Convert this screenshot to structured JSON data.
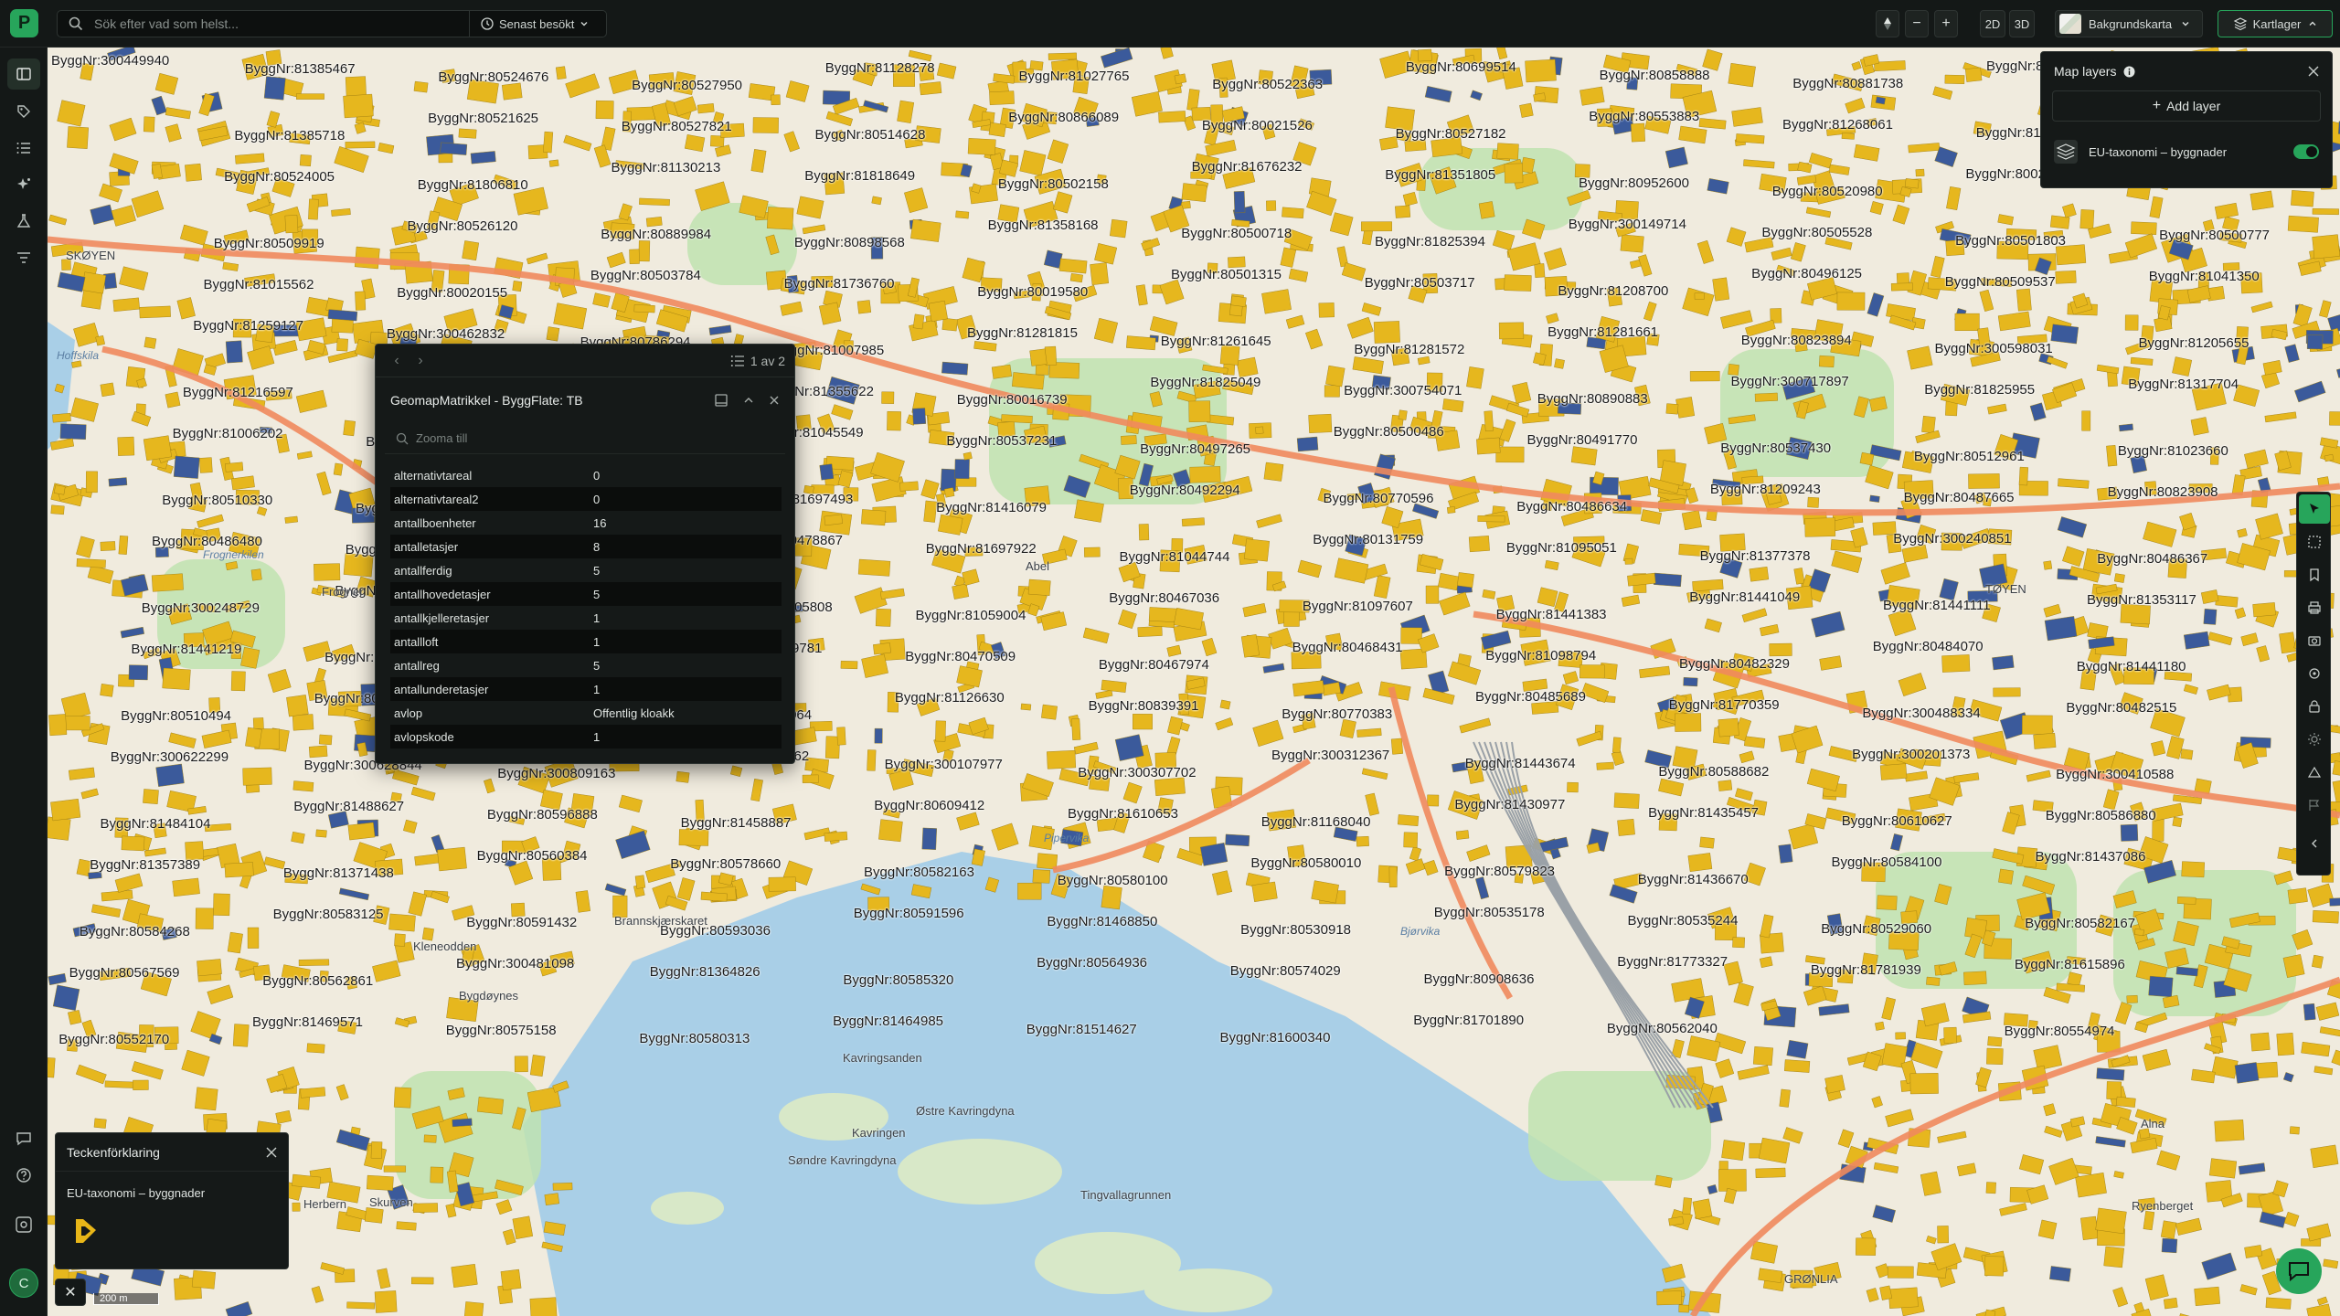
{
  "topbar": {
    "logo": "P",
    "search_placeholder": "Sök efter vad som helst...",
    "recent_label": "Senast besökt",
    "zoom_out": "−",
    "zoom_in": "+",
    "mode_2d": "2D",
    "mode_3d": "3D",
    "basemap_label": "Bakgrundskarta",
    "maptypes_label": "Kartlager"
  },
  "sidebar": {
    "icons": [
      "map-icon",
      "tag-icon",
      "list-icon",
      "sparkle-icon",
      "flask-icon",
      "filter-icon"
    ],
    "bottom_icons": [
      "chat-bubble-icon",
      "help-icon",
      "settings-icon"
    ],
    "avatar": "C"
  },
  "map": {
    "building_labels": [
      {
        "t": "ByggNr:300449940"
      },
      {
        "t": "ByggNr:81385467"
      },
      {
        "t": "ByggNr:80524676"
      },
      {
        "t": "ByggNr:80527950"
      },
      {
        "t": "ByggNr:81128278"
      },
      {
        "t": "ByggNr:81027765"
      },
      {
        "t": "ByggNr:80522363"
      },
      {
        "t": "ByggNr:80699514"
      },
      {
        "t": "ByggNr:80858888"
      },
      {
        "t": "ByggNr:80881738"
      },
      {
        "t": "ByggNr:80523637"
      },
      {
        "t": "ByggNr:80515464"
      },
      {
        "t": "ByggNr:81385718"
      },
      {
        "t": "ByggNr:80521625"
      },
      {
        "t": "ByggNr:80527821"
      },
      {
        "t": "ByggNr:80514628"
      },
      {
        "t": "ByggNr:80866089"
      },
      {
        "t": "ByggNr:80021526"
      },
      {
        "t": "ByggNr:80527182"
      },
      {
        "t": "ByggNr:80553883"
      },
      {
        "t": "ByggNr:81268061"
      },
      {
        "t": "ByggNr:81268347"
      },
      {
        "t": "ByggNr:81351570"
      },
      {
        "t": "ByggNr:80524005"
      },
      {
        "t": "ByggNr:81806810"
      },
      {
        "t": "ByggNr:81130213"
      },
      {
        "t": "ByggNr:81818649"
      },
      {
        "t": "ByggNr:80502158"
      },
      {
        "t": "ByggNr:81676232"
      },
      {
        "t": "ByggNr:81351805"
      },
      {
        "t": "ByggNr:80952600"
      },
      {
        "t": "ByggNr:80520980"
      },
      {
        "t": "ByggNr:80020120"
      },
      {
        "t": "ByggNr:80500777"
      },
      {
        "t": "ByggNr:80509919"
      },
      {
        "t": "ByggNr:80526120"
      },
      {
        "t": "ByggNr:80889984"
      },
      {
        "t": "ByggNr:80898568"
      },
      {
        "t": "ByggNr:81358168"
      },
      {
        "t": "ByggNr:80500718"
      },
      {
        "t": "ByggNr:81825394"
      },
      {
        "t": "ByggNr:300149714"
      },
      {
        "t": "ByggNr:80505528"
      },
      {
        "t": "ByggNr:80501803"
      },
      {
        "t": "ByggNr:81041350"
      },
      {
        "t": "ByggNr:81015562"
      },
      {
        "t": "ByggNr:80020155"
      },
      {
        "t": "ByggNr:80503784"
      },
      {
        "t": "ByggNr:81736760"
      },
      {
        "t": "ByggNr:80019580"
      },
      {
        "t": "ByggNr:80501315"
      },
      {
        "t": "ByggNr:80503717"
      },
      {
        "t": "ByggNr:81208700"
      },
      {
        "t": "ByggNr:80496125"
      },
      {
        "t": "ByggNr:80509537"
      },
      {
        "t": "ByggNr:81205655"
      },
      {
        "t": "ByggNr:81259127"
      },
      {
        "t": "ByggNr:300462832"
      },
      {
        "t": "ByggNr:80786294"
      },
      {
        "t": "ByggNr:81007985"
      },
      {
        "t": "ByggNr:81281815"
      },
      {
        "t": "ByggNr:81261645"
      },
      {
        "t": "ByggNr:81281572"
      },
      {
        "t": "ByggNr:81281661"
      },
      {
        "t": "ByggNr:80823894"
      },
      {
        "t": "ByggNr:300598031"
      },
      {
        "t": "ByggNr:81317704"
      },
      {
        "t": "ByggNr:81216597"
      },
      {
        "t": "ByggNr:80878265"
      },
      {
        "t": "ByggNr:81317459"
      },
      {
        "t": "ByggNr:81355622"
      },
      {
        "t": "ByggNr:80016739"
      },
      {
        "t": "ByggNr:81825049"
      },
      {
        "t": "ByggNr:300754071"
      },
      {
        "t": "ByggNr:80890883"
      },
      {
        "t": "ByggNr:300717897"
      },
      {
        "t": "ByggNr:81825955"
      },
      {
        "t": "ByggNr:81023660"
      },
      {
        "t": "ByggNr:81006202"
      },
      {
        "t": "ByggNr:81180059"
      },
      {
        "t": "ByggNr:80014574"
      },
      {
        "t": "ByggNr:81045549"
      },
      {
        "t": "ByggNr:80537231"
      },
      {
        "t": "ByggNr:80497265"
      },
      {
        "t": "ByggNr:80500486"
      },
      {
        "t": "ByggNr:80491770"
      },
      {
        "t": "ByggNr:80537430"
      },
      {
        "t": "ByggNr:80512961"
      },
      {
        "t": "ByggNr:80823908"
      },
      {
        "t": "ByggNr:80510330"
      },
      {
        "t": "ByggNr:81415945"
      },
      {
        "t": "ByggNr:80509204"
      },
      {
        "t": "ByggNr:81697493"
      },
      {
        "t": "ByggNr:81416079"
      },
      {
        "t": "ByggNr:80492294"
      },
      {
        "t": "ByggNr:80770596"
      },
      {
        "t": "ByggNr:80486634"
      },
      {
        "t": "ByggNr:81209243"
      },
      {
        "t": "ByggNr:80487665"
      },
      {
        "t": "ByggNr:80486367"
      },
      {
        "t": "ByggNr:80486480"
      },
      {
        "t": "ByggNr:80489064"
      },
      {
        "t": "ByggNr:81204766"
      },
      {
        "t": "ByggNr:80478867"
      },
      {
        "t": "ByggNr:81697922"
      },
      {
        "t": "ByggNr:81044744"
      },
      {
        "t": "ByggNr:80131759"
      },
      {
        "t": "ByggNr:81095051"
      },
      {
        "t": "ByggNr:81377378"
      },
      {
        "t": "ByggNr:300240851"
      },
      {
        "t": "ByggNr:81353117"
      },
      {
        "t": "ByggNr:300248729"
      },
      {
        "t": "ByggNr:81215146"
      },
      {
        "t": "ByggNr:81166242"
      },
      {
        "t": "ByggNr:81405808"
      },
      {
        "t": "ByggNr:81059004"
      },
      {
        "t": "ByggNr:80467036"
      },
      {
        "t": "ByggNr:81097607"
      },
      {
        "t": "ByggNr:81441383"
      },
      {
        "t": "ByggNr:81441049"
      },
      {
        "t": "ByggNr:81441111"
      },
      {
        "t": "ByggNr:81441180"
      },
      {
        "t": "ByggNr:81441219"
      },
      {
        "t": "ByggNr:81455793"
      },
      {
        "t": "ByggNr:81485690"
      },
      {
        "t": "ByggNr:81849781"
      },
      {
        "t": "ByggNr:80470509"
      },
      {
        "t": "ByggNr:80467974"
      },
      {
        "t": "ByggNr:80468431"
      },
      {
        "t": "ByggNr:81098794"
      },
      {
        "t": "ByggNr:80482329"
      },
      {
        "t": "ByggNr:80484070"
      },
      {
        "t": "ByggNr:80482515"
      },
      {
        "t": "ByggNr:80510494"
      },
      {
        "t": "ByggNr:80478097"
      },
      {
        "t": "ByggNr:80480288"
      },
      {
        "t": "ByggNr:81079064"
      },
      {
        "t": "ByggNr:81126630"
      },
      {
        "t": "ByggNr:80839391"
      },
      {
        "t": "ByggNr:80770383"
      },
      {
        "t": "ByggNr:80485689"
      },
      {
        "t": "ByggNr:81770359"
      },
      {
        "t": "ByggNr:300488334"
      },
      {
        "t": "ByggNr:300410588"
      },
      {
        "t": "ByggNr:300622299"
      },
      {
        "t": "ByggNr:300628844"
      },
      {
        "t": "ByggNr:300809163"
      },
      {
        "t": "ByggNr:300368362"
      },
      {
        "t": "ByggNr:300107977"
      },
      {
        "t": "ByggNr:300307702"
      },
      {
        "t": "ByggNr:300312367"
      },
      {
        "t": "ByggNr:81443674"
      },
      {
        "t": "ByggNr:80588682"
      },
      {
        "t": "ByggNr:300201373"
      },
      {
        "t": "ByggNr:80586880"
      },
      {
        "t": "ByggNr:81484104"
      },
      {
        "t": "ByggNr:81488627"
      },
      {
        "t": "ByggNr:80596888"
      },
      {
        "t": "ByggNr:81458887"
      },
      {
        "t": "ByggNr:80609412"
      },
      {
        "t": "ByggNr:81610653"
      },
      {
        "t": "ByggNr:81168040"
      },
      {
        "t": "ByggNr:81430977"
      },
      {
        "t": "ByggNr:81435457"
      },
      {
        "t": "ByggNr:80610627"
      },
      {
        "t": "ByggNr:81437086"
      },
      {
        "t": "ByggNr:81357389"
      },
      {
        "t": "ByggNr:81371438"
      },
      {
        "t": "ByggNr:80560384"
      },
      {
        "t": "ByggNr:80578660"
      },
      {
        "t": "ByggNr:80582163"
      },
      {
        "t": "ByggNr:80580100"
      },
      {
        "t": "ByggNr:80580010"
      },
      {
        "t": "ByggNr:80579823"
      },
      {
        "t": "ByggNr:81436670"
      },
      {
        "t": "ByggNr:80584100"
      },
      {
        "t": "ByggNr:80582167"
      },
      {
        "t": "ByggNr:80584268"
      },
      {
        "t": "ByggNr:80583125"
      },
      {
        "t": "ByggNr:80591432"
      },
      {
        "t": "ByggNr:80593036"
      },
      {
        "t": "ByggNr:80591596"
      },
      {
        "t": "ByggNr:81468850"
      },
      {
        "t": "ByggNr:80530918"
      },
      {
        "t": "ByggNr:80535178"
      },
      {
        "t": "ByggNr:80535244"
      },
      {
        "t": "ByggNr:80529060"
      },
      {
        "t": "ByggNr:81615896"
      },
      {
        "t": "ByggNr:80567569"
      },
      {
        "t": "ByggNr:80562861"
      },
      {
        "t": "ByggNr:300481098"
      },
      {
        "t": "ByggNr:81364826"
      },
      {
        "t": "ByggNr:80585320"
      },
      {
        "t": "ByggNr:80564936"
      },
      {
        "t": "ByggNr:80574029"
      },
      {
        "t": "ByggNr:80908636"
      },
      {
        "t": "ByggNr:81773327"
      },
      {
        "t": "ByggNr:81781939"
      },
      {
        "t": "ByggNr:80554974"
      },
      {
        "t": "ByggNr:80552170"
      },
      {
        "t": "ByggNr:81469571"
      },
      {
        "t": "ByggNr:80575158"
      },
      {
        "t": "ByggNr:80580313"
      },
      {
        "t": "ByggNr:81464985"
      },
      {
        "t": "ByggNr:81514627"
      },
      {
        "t": "ByggNr:81600340"
      },
      {
        "t": "ByggNr:81701890"
      },
      {
        "t": "ByggNr:80562040"
      }
    ],
    "place_labels": [
      {
        "t": "SKØYEN"
      },
      {
        "t": "Abel"
      },
      {
        "t": "Kavringsanden"
      },
      {
        "t": "Østre Kavringdyna"
      },
      {
        "t": "Søndre Kavringdyna"
      },
      {
        "t": "Kavringen"
      },
      {
        "t": "Tingvallagrunnen"
      },
      {
        "t": "Brannskjærskaret"
      },
      {
        "t": "Kleneodden"
      },
      {
        "t": "Bygdøynes"
      },
      {
        "t": "Herbern"
      },
      {
        "t": "Skurven"
      },
      {
        "t": "Bjørvika"
      },
      {
        "t": "Pipervika"
      },
      {
        "t": "Frognerkilen"
      },
      {
        "t": "TØYEN"
      },
      {
        "t": "GRØNLIA"
      },
      {
        "t": "Hoffskila"
      },
      {
        "t": "Alna"
      },
      {
        "t": "Ryenberget"
      },
      {
        "t": "Frogner"
      }
    ],
    "scale_label": "200 m"
  },
  "popup": {
    "page_count": "1 av 2",
    "title": "GeomapMatrikkel - ByggFlate: TB",
    "zoom_label": "Zooma till",
    "attributes": [
      {
        "key": "alternativtareal",
        "value": "0"
      },
      {
        "key": "alternativtareal2",
        "value": "0"
      },
      {
        "key": "antallboenheter",
        "value": "16"
      },
      {
        "key": "antalletasjer",
        "value": "8"
      },
      {
        "key": "antallferdig",
        "value": "5"
      },
      {
        "key": "antallhovedetasjer",
        "value": "5"
      },
      {
        "key": "antallkjelleretasjer",
        "value": "1"
      },
      {
        "key": "antallloft",
        "value": "1"
      },
      {
        "key": "antallreg",
        "value": "5"
      },
      {
        "key": "antallunderetasjer",
        "value": "1"
      },
      {
        "key": "avlop",
        "value": "Offentlig kloakk"
      },
      {
        "key": "avlopskode",
        "value": "1"
      }
    ]
  },
  "layers_panel": {
    "title": "Map layers",
    "add_label": "Add layer",
    "layers": [
      {
        "name": "EU-taxonomi – byggnader",
        "visible": true
      }
    ]
  },
  "tools": [
    "select-cursor-icon",
    "box-select-icon",
    "bookmark-icon",
    "print-icon",
    "camera-icon",
    "target-icon",
    "lock-layer-icon",
    "sun-icon",
    "measure-icon",
    "flag-icon",
    "collapse-icon"
  ],
  "legend": {
    "title": "Teckenförklaring",
    "layer_name": "EU-taxonomi – byggnader",
    "swatch_color": "#e8b618"
  },
  "colors": {
    "accent": "#27a55b",
    "building_fill": "#e6b71e",
    "building_highlight": "#3b5a9b",
    "park": "#bfe3b0",
    "water": "#a9cfe7",
    "land": "#f0ebde"
  }
}
